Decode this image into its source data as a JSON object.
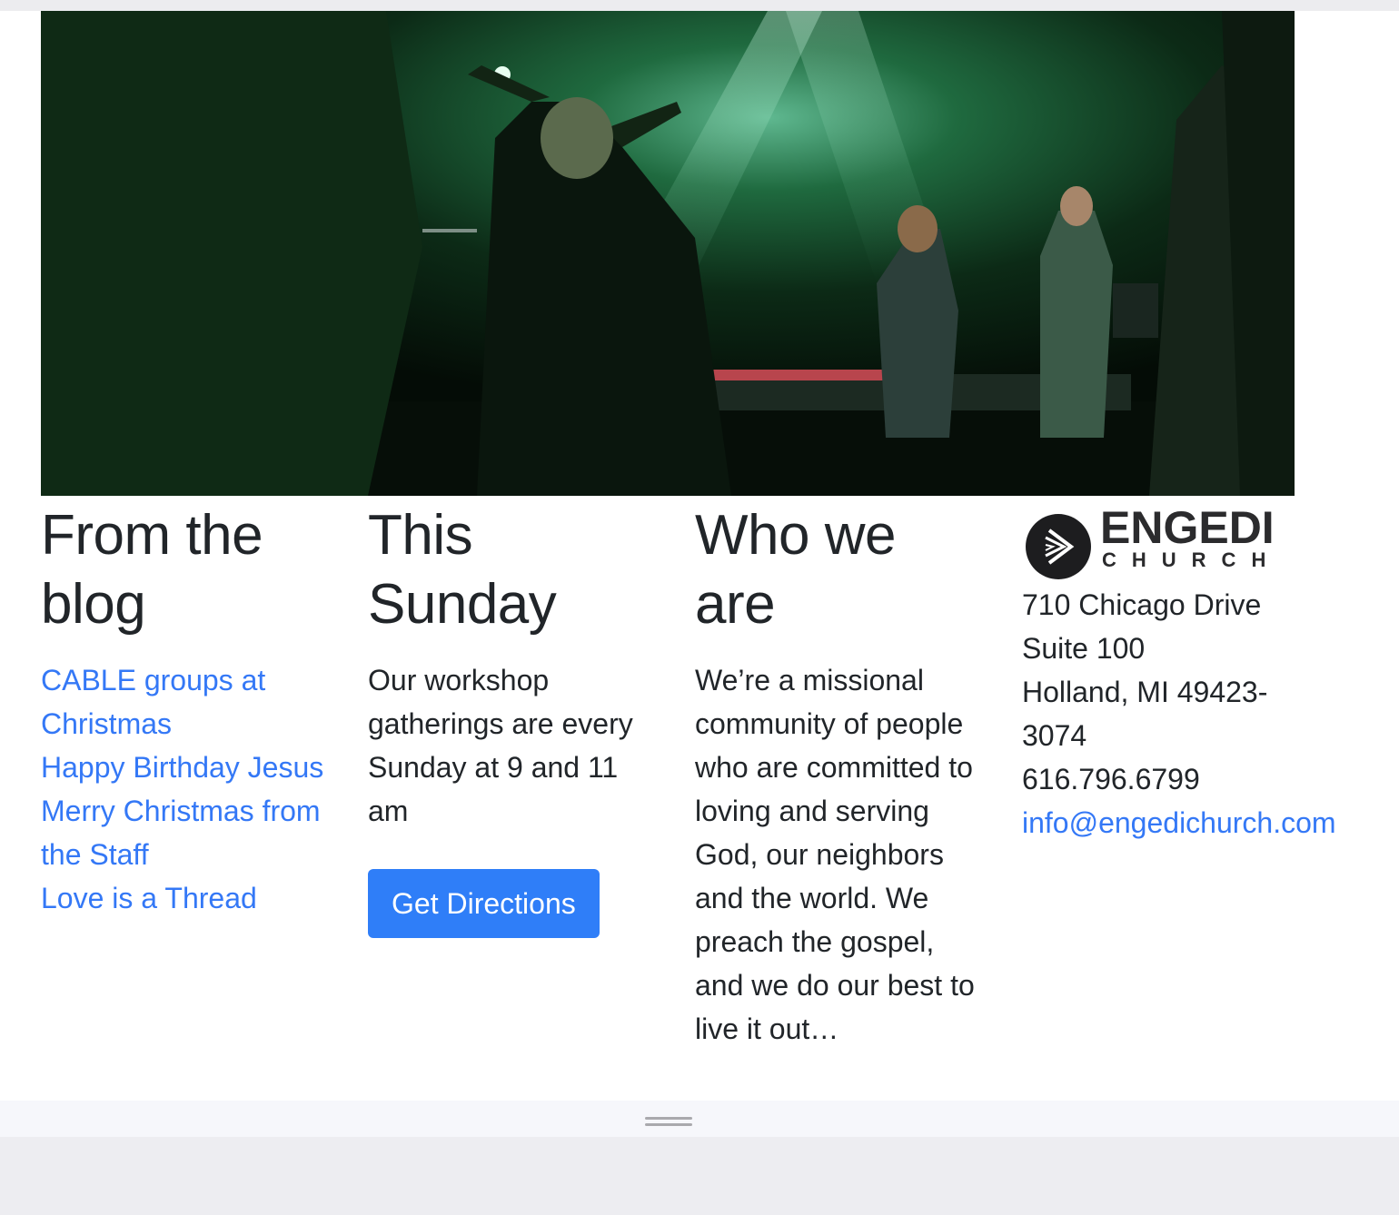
{
  "blog": {
    "heading": "From the blog",
    "links": [
      "CABLE groups at Christmas",
      "Happy Birthday Jesus",
      "Merry Christmas from the Staff",
      "Love is a Thread"
    ]
  },
  "sunday": {
    "heading": "This Sunday",
    "text": "Our workshop gatherings are every Sunday at 9 and 11 am",
    "button_label": "Get Directions"
  },
  "about": {
    "heading": "Who we are",
    "text": "We’re a missional community of people who are committed to loving and serving God, our neighbors and the world. We preach the gospel, and we do our best to live it out…"
  },
  "contact": {
    "logo_word": "ENGEDI",
    "logo_sub": "CHURCH",
    "address_line1": "710 Chicago Drive",
    "address_line2": "Suite 100",
    "address_line3": "Holland, MI 49423-3074",
    "phone": "616.796.6799",
    "email": "info@engedichurch.com"
  },
  "colors": {
    "link": "#3478f6",
    "button": "#2f7ef8",
    "text": "#212529"
  },
  "icons": [
    "play-chevron-logo-icon",
    "resize-grip-icon"
  ]
}
